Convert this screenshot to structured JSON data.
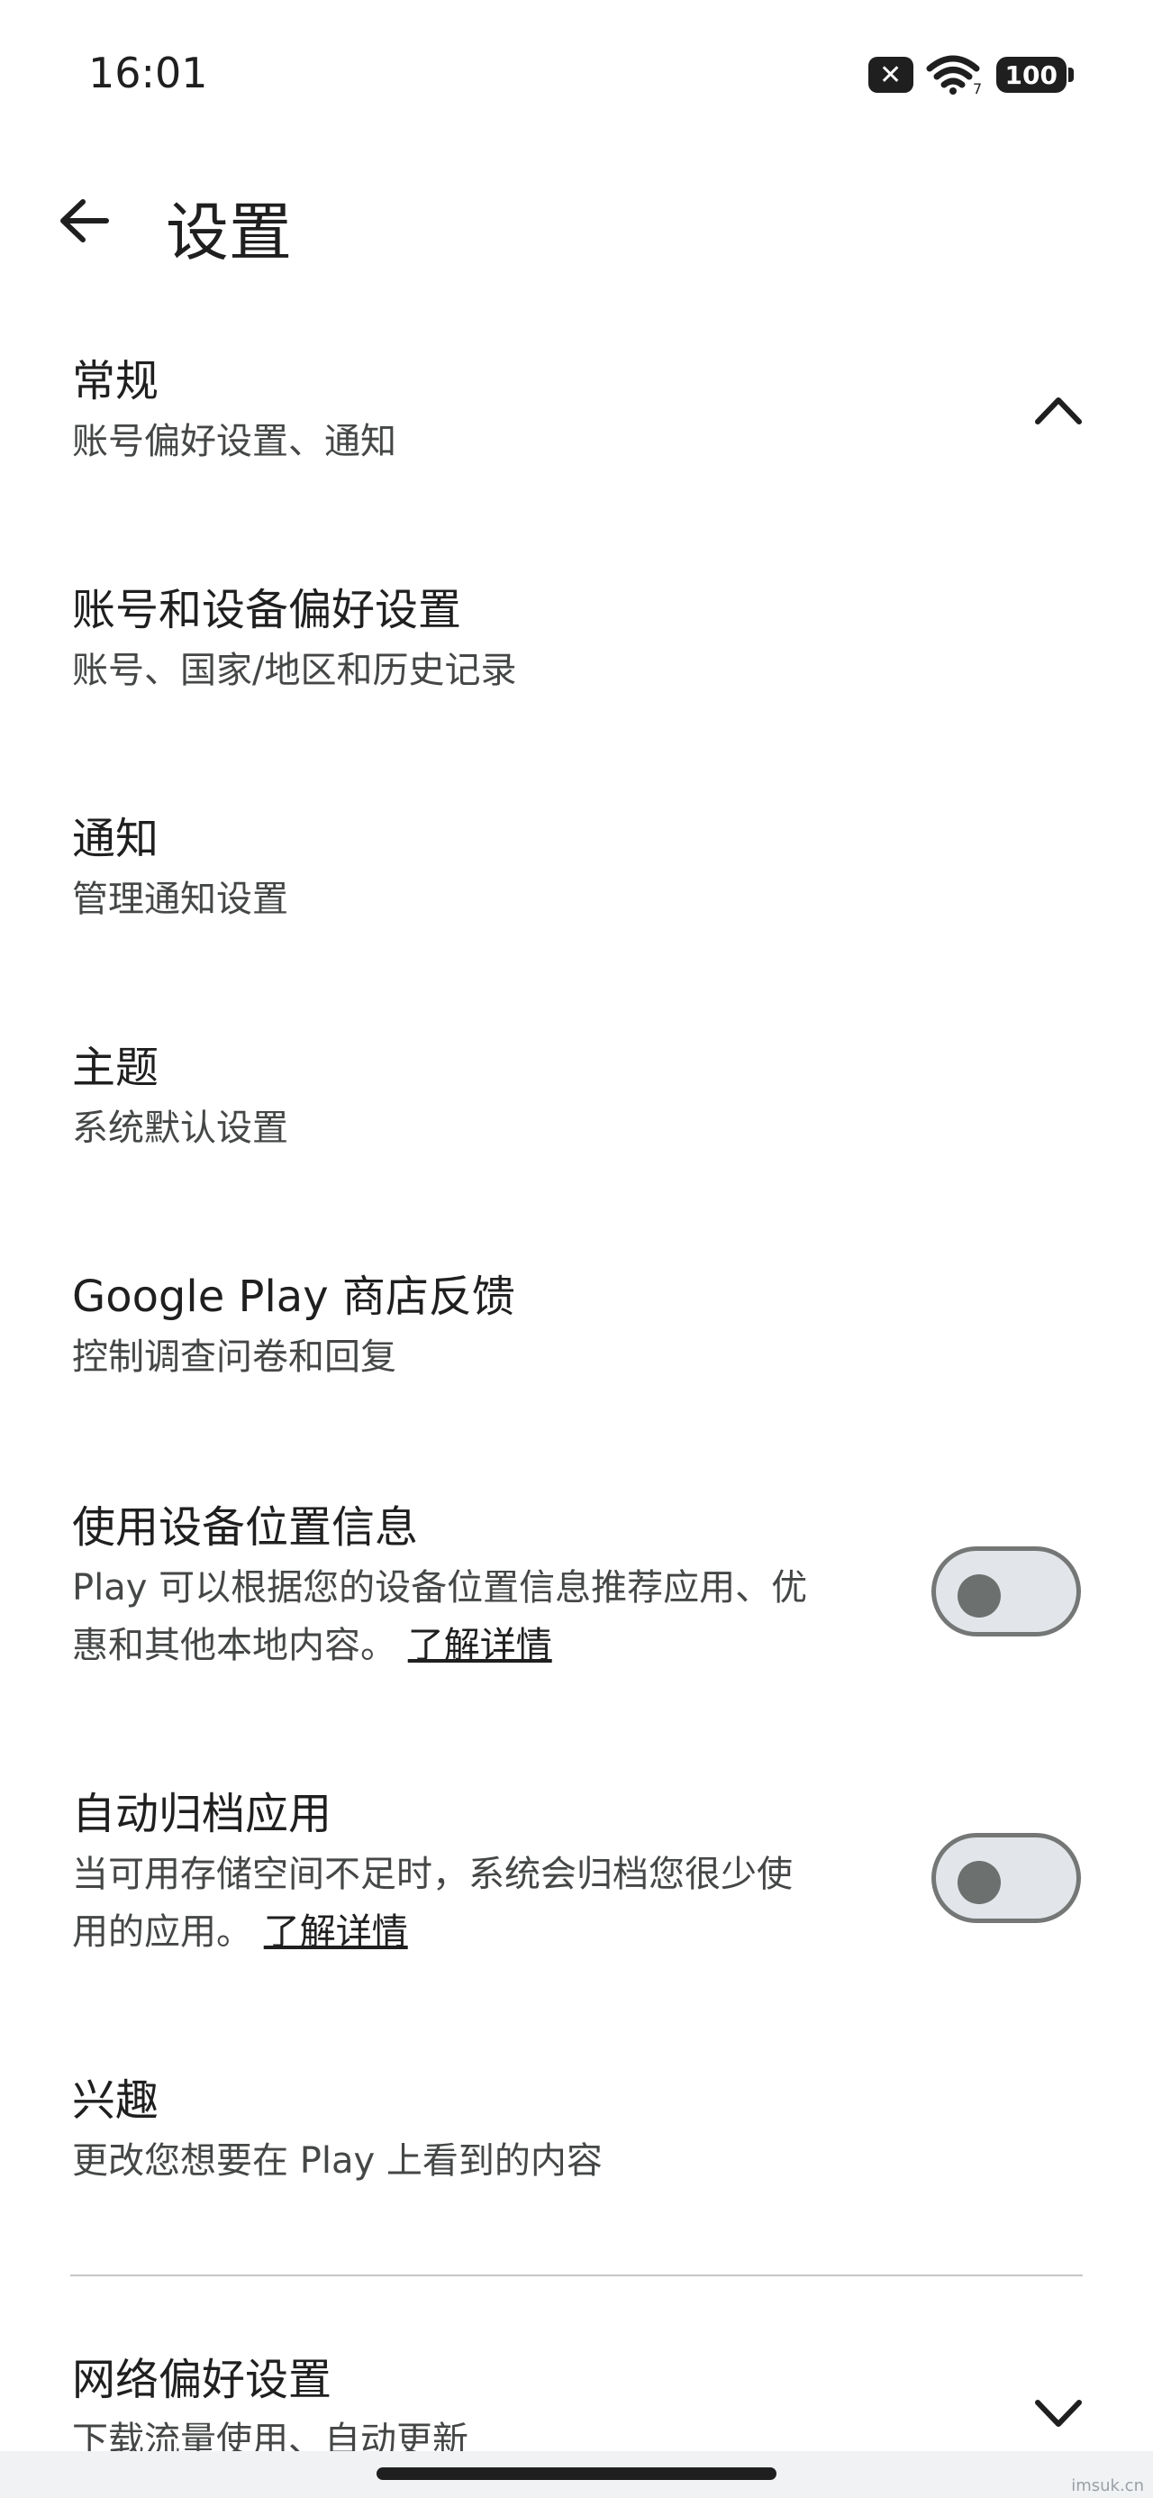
{
  "status_bar": {
    "time": "16:01",
    "wifi_badge": "7",
    "battery": "100"
  },
  "header": {
    "title": "设置"
  },
  "sections": [
    {
      "title": "常规",
      "subtitle": "账号偏好设置、通知"
    },
    {
      "title": "账号和设备偏好设置",
      "subtitle": "账号、国家/地区和历史记录"
    },
    {
      "title": "通知",
      "subtitle": "管理通知设置"
    },
    {
      "title": "主题",
      "subtitle": "系统默认设置"
    },
    {
      "title": "Google Play 商店反馈",
      "subtitle": "控制调查问卷和回复"
    },
    {
      "title": "使用设备位置信息",
      "subtitle_line1": "Play 可以根据您的设备位置信息推荐应用、优",
      "subtitle_line2": "惠和其他本地内容。",
      "link": "了解详情"
    },
    {
      "title": "自动归档应用",
      "subtitle_line1": "当可用存储空间不足时，系统会归档您很少使",
      "subtitle_line2": "用的应用。",
      "link": "了解详情"
    },
    {
      "title": "兴趣",
      "subtitle": "更改您想要在 Play 上看到的内容"
    },
    {
      "title": "网络偏好设置",
      "subtitle": "下载流量使用、自动更新"
    }
  ],
  "toggles": {
    "location_on": false,
    "auto_archive_on": false
  },
  "watermark": "imsuk.cn"
}
